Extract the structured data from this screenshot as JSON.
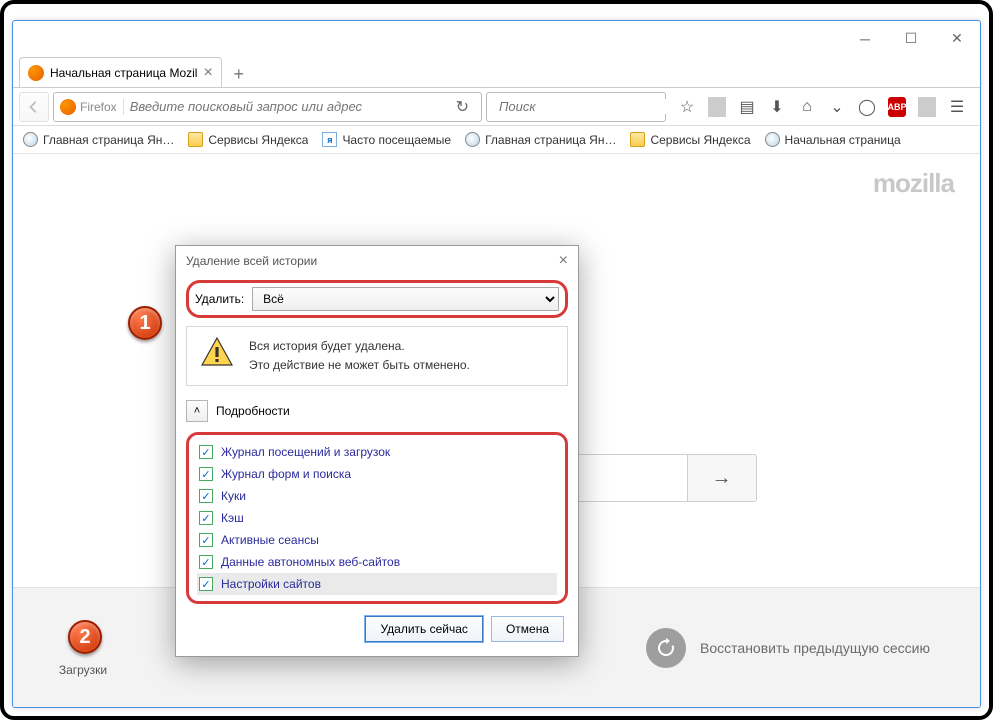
{
  "window": {
    "tab_title": "Начальная страница Mozil",
    "url_identity": "Firefox",
    "url_placeholder": "Введите поисковый запрос или адрес",
    "search_placeholder": "Поиск"
  },
  "bookmarks": [
    "Главная страница Ян…",
    "Сервисы Яндекса",
    "Часто посещаемые",
    "Главная страница Ян…",
    "Сервисы Яндекса",
    "Начальная страница"
  ],
  "brand": "mozilla",
  "bottom": {
    "downloads": "Загрузки",
    "restore": "Восстановить предыдущую сессию"
  },
  "dialog": {
    "title": "Удаление всей истории",
    "range_label": "Удалить:",
    "range_value": "Всё",
    "warn_line1": "Вся история будет удалена.",
    "warn_line2": "Это действие не может быть отменено.",
    "details_label": "Подробности",
    "checks": [
      "Журнал посещений и загрузок",
      "Журнал форм и поиска",
      "Куки",
      "Кэш",
      "Активные сеансы",
      "Данные автономных веб-сайтов",
      "Настройки сайтов"
    ],
    "btn_clear": "Удалить сейчас",
    "btn_cancel": "Отмена"
  },
  "markers": {
    "m1": "1",
    "m2": "2"
  }
}
